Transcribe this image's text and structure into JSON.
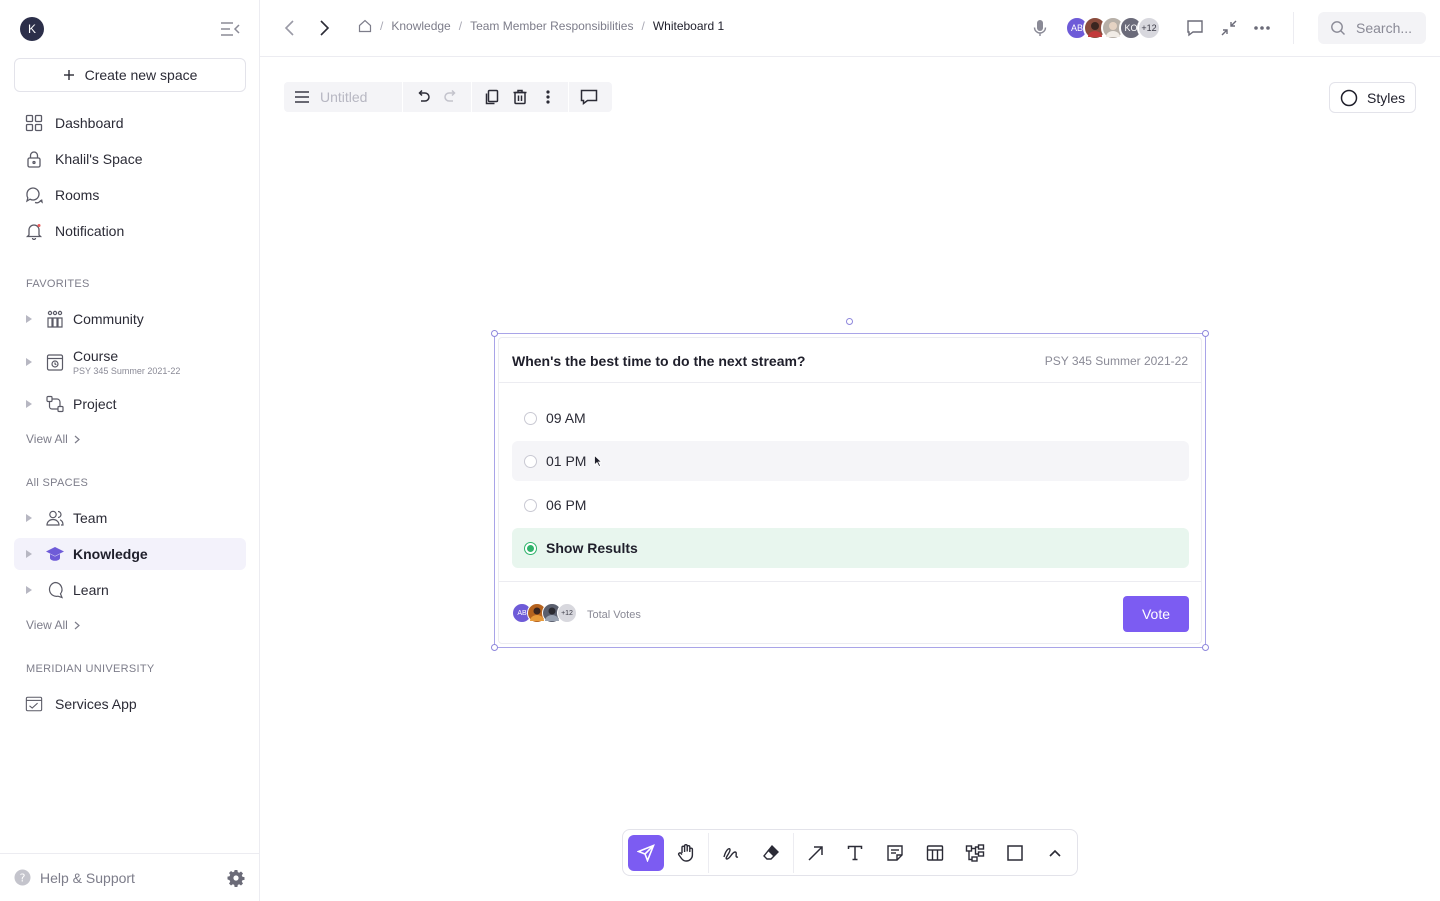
{
  "sidebar": {
    "user_initial": "K",
    "create_label": "Create new space",
    "nav": [
      {
        "label": "Dashboard",
        "icon": "grid-icon"
      },
      {
        "label": "Khalil's Space",
        "icon": "lock-icon"
      },
      {
        "label": "Rooms",
        "icon": "chat-bubbles-icon"
      },
      {
        "label": "Notification",
        "icon": "bell-icon"
      }
    ],
    "favorites_label": "FAVORITES",
    "favorites": [
      {
        "label": "Community",
        "sub": "",
        "icon": "community-icon"
      },
      {
        "label": "Course",
        "sub": "PSY 345 Summer 2021-22",
        "icon": "course-icon"
      },
      {
        "label": "Project",
        "sub": "",
        "icon": "project-icon"
      }
    ],
    "view_all": "View All",
    "all_spaces_label": "All SPACES",
    "spaces": [
      {
        "label": "Team",
        "icon": "people-icon"
      },
      {
        "label": "Knowledge",
        "icon": "graduation-cap-icon"
      },
      {
        "label": "Learn",
        "icon": "learn-icon"
      }
    ],
    "org_label": "MERIDIAN UNIVERSITY",
    "org_item": "Services App",
    "help_label": "Help & Support"
  },
  "topbar": {
    "breadcrumbs": [
      "Knowledge",
      "Team Member Responsibilities",
      "Whiteboard 1"
    ],
    "avatars": [
      {
        "initials": "AB",
        "color": "#6e5bd8"
      },
      {
        "initials": "",
        "color": "#8a4b3c"
      },
      {
        "initials": "",
        "color": "#b7b0a8"
      },
      {
        "initials": "KO",
        "color": "#6b6b7a"
      },
      {
        "initials": "+12",
        "color": "#d8d8de"
      }
    ],
    "search_placeholder": "Search..."
  },
  "canvas_toolbar": {
    "title_placeholder": "Untitled"
  },
  "styles_label": "Styles",
  "poll": {
    "question": "When's the best time to do the next stream?",
    "course": "PSY 345 Summer 2021-22",
    "options": [
      {
        "label": "09 AM",
        "selected": false
      },
      {
        "label": "01 PM",
        "selected": false
      },
      {
        "label": "06 PM",
        "selected": false
      },
      {
        "label": "Show Results",
        "selected": true
      }
    ],
    "footer_avatars": [
      {
        "initials": "AB",
        "color": "#6e5bd8"
      },
      {
        "initials": "",
        "color": "#b5621e"
      },
      {
        "initials": "",
        "color": "#5a5f6e"
      },
      {
        "initials": "+12",
        "color": "#d8d8de"
      }
    ],
    "total_votes_label": "Total Votes",
    "vote_label": "Vote"
  },
  "colors": {
    "accent": "#7c5cf2",
    "selected_bg": "#e8f6ee",
    "selected_radio": "#2fb36b"
  }
}
